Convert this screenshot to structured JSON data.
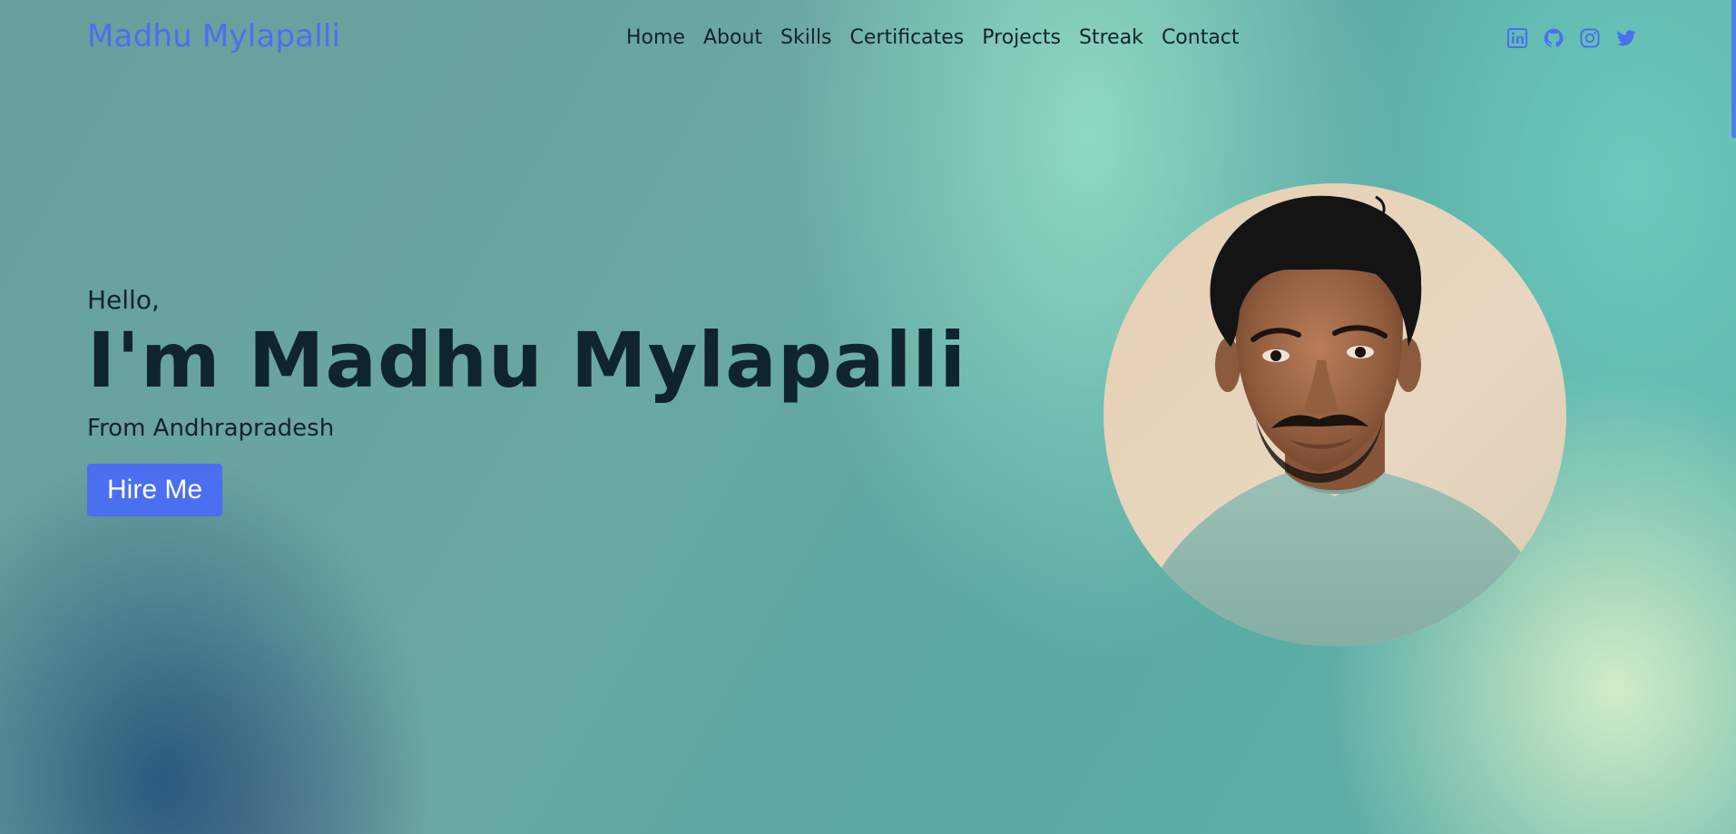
{
  "brand": {
    "name": "Madhu Mylapalli",
    "color": "#4a6ff0"
  },
  "nav": {
    "items": [
      {
        "label": "Home"
      },
      {
        "label": "About"
      },
      {
        "label": "Skills"
      },
      {
        "label": "Certificates"
      },
      {
        "label": "Projects"
      },
      {
        "label": "Streak"
      },
      {
        "label": "Contact"
      }
    ]
  },
  "socials": [
    {
      "icon": "linkedin-icon"
    },
    {
      "icon": "github-icon"
    },
    {
      "icon": "instagram-icon"
    },
    {
      "icon": "twitter-icon"
    }
  ],
  "hero": {
    "greeting": "Hello,",
    "headline": "I'm Madhu Mylapalli",
    "subtitle": "From Andhrapradesh",
    "cta_label": "Hire Me"
  },
  "profile_photo": {
    "icon": "profile-photo"
  },
  "colors": {
    "accent": "#4a6ff0",
    "text_dark": "#10242f"
  }
}
